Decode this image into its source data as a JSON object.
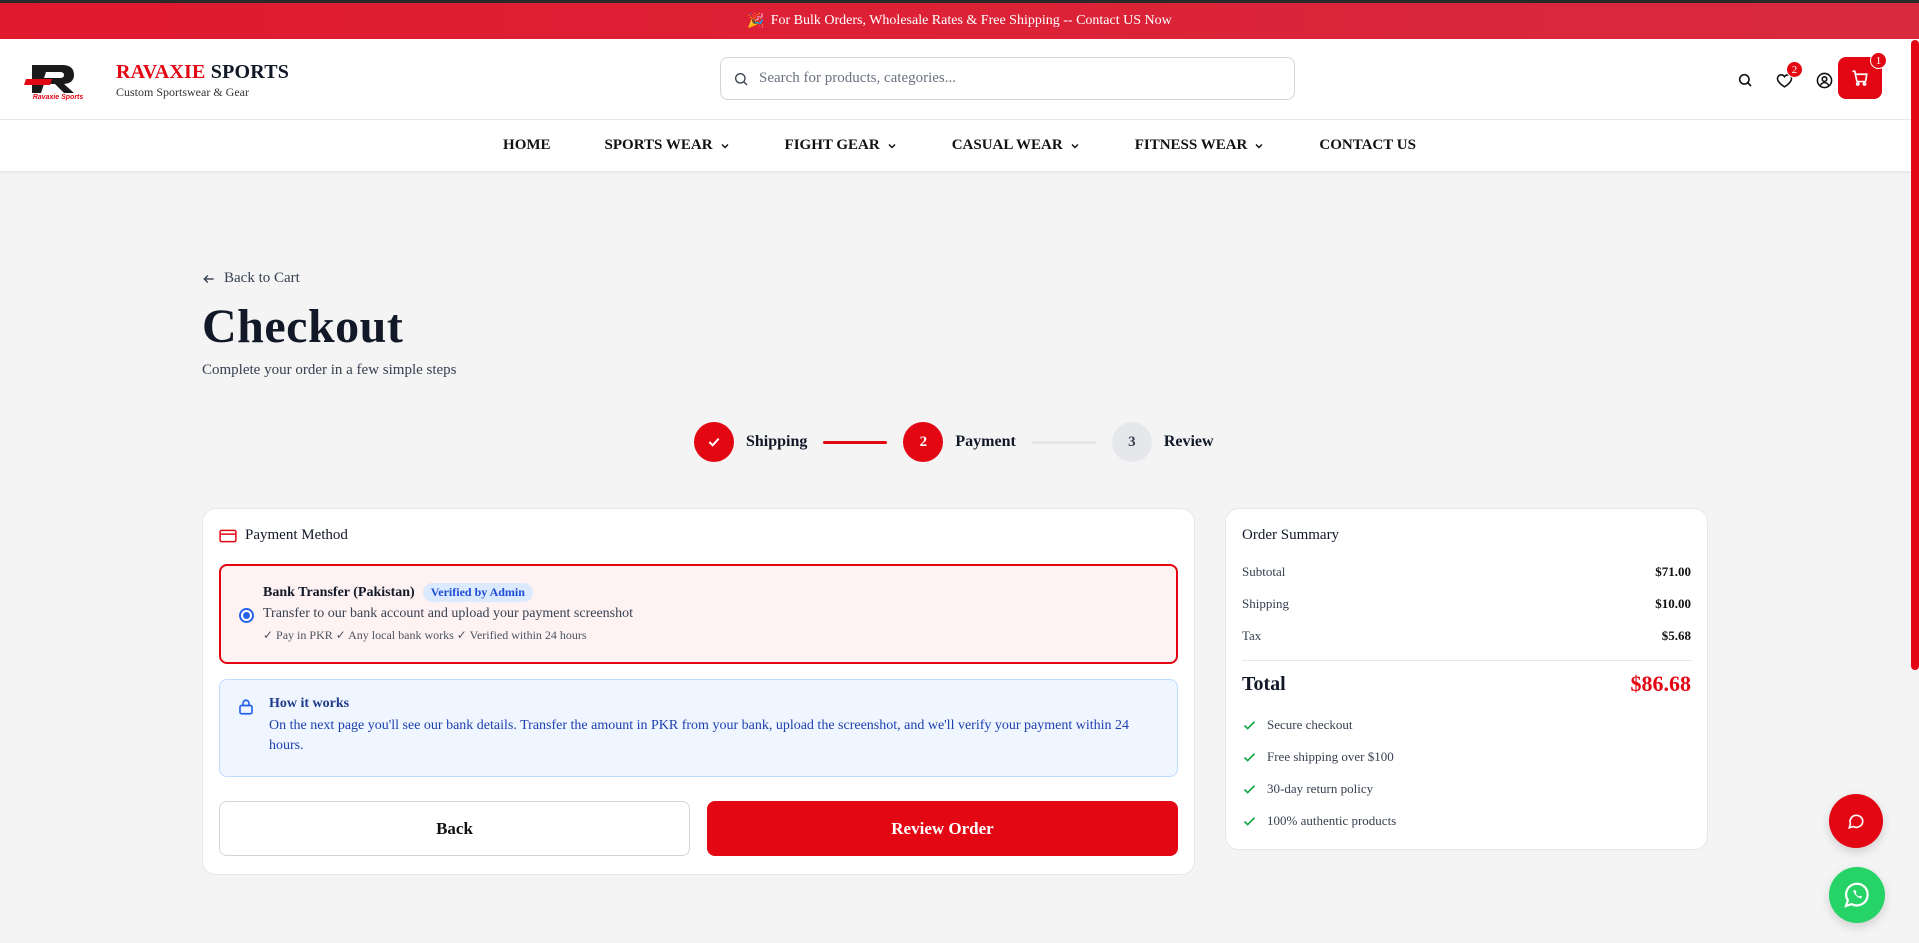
{
  "announcement": {
    "icon": "🎉",
    "text": "For Bulk Orders, Wholesale Rates & Free Shipping -- Contact US Now"
  },
  "brand": {
    "name_primary": "RAVAXIE",
    "name_secondary": "SPORTS",
    "tagline": "Custom Sportswear & Gear",
    "color": "#e30613"
  },
  "search": {
    "placeholder": "Search for products, categories..."
  },
  "header": {
    "wishlist_count": "2",
    "cart_count": "1"
  },
  "nav": [
    {
      "label": "HOME"
    },
    {
      "label": "SPORTS WEAR"
    },
    {
      "label": "FIGHT GEAR"
    },
    {
      "label": "CASUAL WEAR"
    },
    {
      "label": "FITNESS WEAR"
    },
    {
      "label": "CONTACT US"
    }
  ],
  "page": {
    "back_link": "Back to Cart",
    "title": "Checkout",
    "subtitle": "Complete your order in a few simple steps"
  },
  "steps": [
    {
      "number": "1",
      "label": "Shipping",
      "state": "done"
    },
    {
      "number": "2",
      "label": "Payment",
      "state": "active"
    },
    {
      "number": "3",
      "label": "Review",
      "state": "todo"
    }
  ],
  "payment": {
    "title": "Payment Method",
    "option": {
      "title": "Bank Transfer (Pakistan)",
      "badge": "Verified by Admin",
      "description": "Transfer to our bank account and upload your payment screenshot",
      "features": "✓ Pay in PKR ✓ Any local bank works ✓ Verified within 24 hours",
      "selected": true
    },
    "info": {
      "title": "How it works",
      "text": "On the next page you'll see our bank details. Transfer the amount in PKR from your bank, upload the screenshot, and we'll verify your payment within 24 hours."
    },
    "back_label": "Back",
    "review_label": "Review Order"
  },
  "summary": {
    "title": "Order Summary",
    "rows": [
      {
        "label": "Subtotal",
        "value": "$71.00"
      },
      {
        "label": "Shipping",
        "value": "$10.00"
      },
      {
        "label": "Tax",
        "value": "$5.68"
      }
    ],
    "total_label": "Total",
    "total_value": "$86.68",
    "features": [
      "Secure checkout",
      "Free shipping over $100",
      "30-day return policy",
      "100% authentic products"
    ]
  }
}
